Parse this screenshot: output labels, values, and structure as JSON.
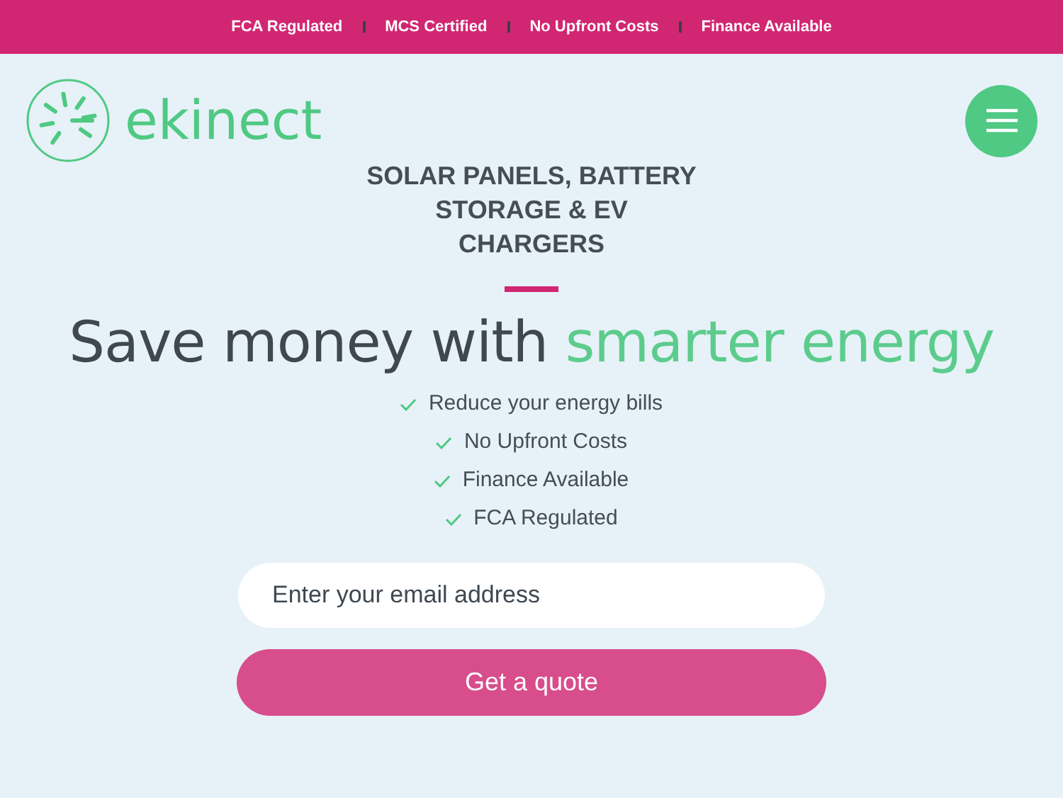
{
  "top_bar": {
    "items": [
      "FCA Regulated",
      "MCS Certified",
      "No Upfront Costs",
      "Finance Available"
    ]
  },
  "header": {
    "logo_text": "ekinect"
  },
  "hero": {
    "subtitle": "SOLAR PANELS, BATTERY STORAGE & EV CHARGERS",
    "headline_lead": "Save money with",
    "headline_accent": "smarter energy",
    "benefits": [
      "Reduce your energy bills",
      "No Upfront Costs",
      "Finance Available",
      "FCA Regulated"
    ]
  },
  "form": {
    "email": {
      "placeholder": "Enter your email address"
    },
    "button": "Get a quote"
  }
}
